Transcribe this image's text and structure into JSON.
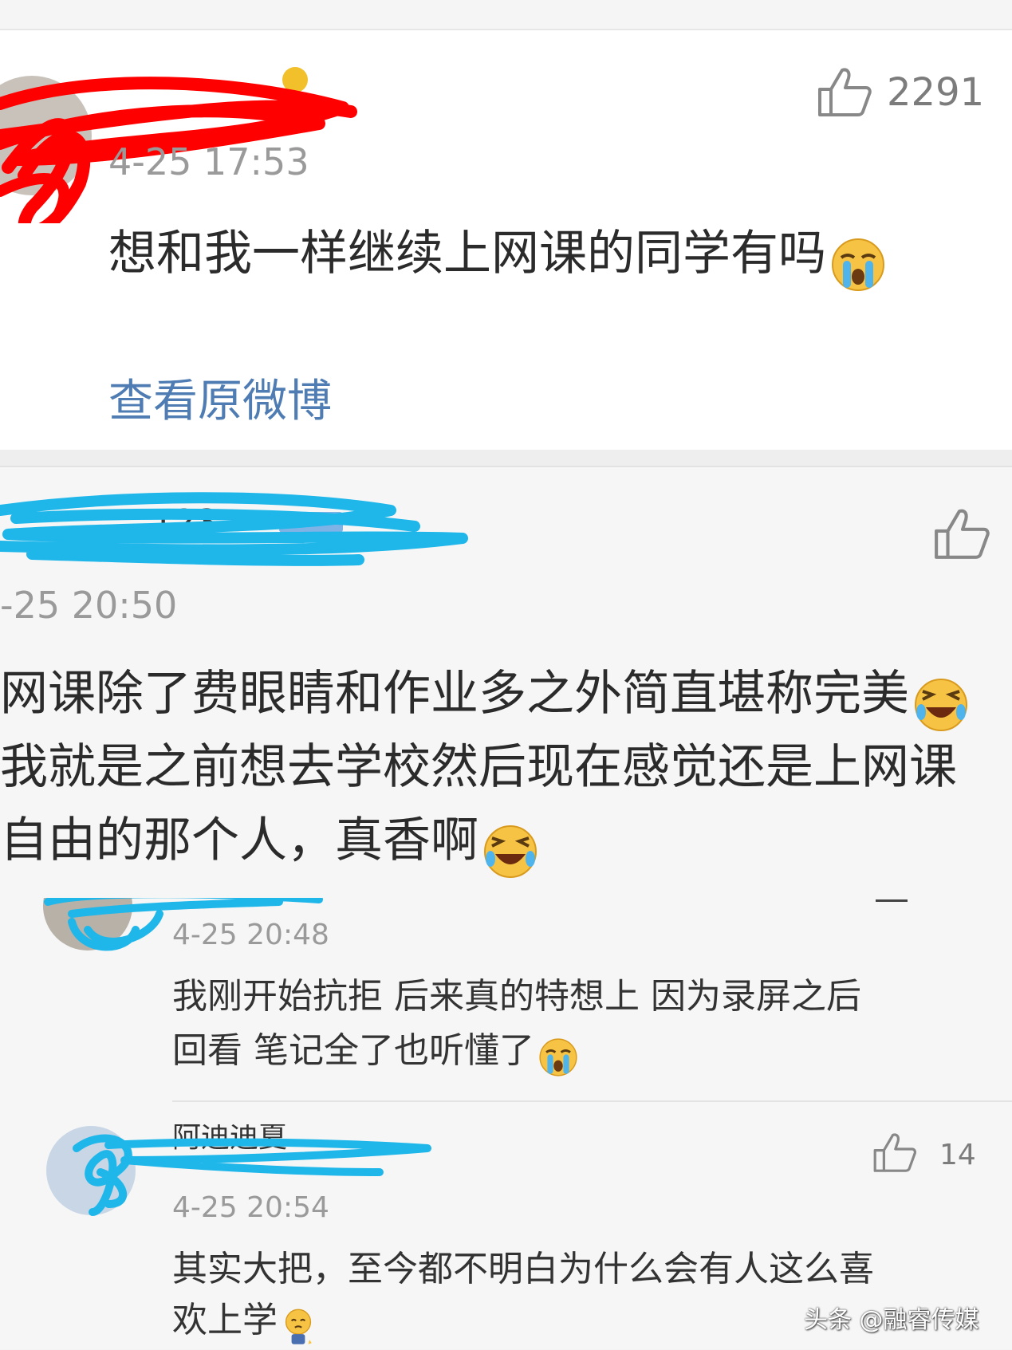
{
  "post": {
    "likes": "2291",
    "time": "4-25 17:53",
    "text": "想和我一样继续上网课的同学有吗",
    "view_original": "查看原微博"
  },
  "comment": {
    "time": "-25 20:50",
    "line1": "网课除了费眼睛和作业多之外简直堪称完美",
    "line2": "我就是之前想去学校然后现在感觉还是上网课",
    "line3": "自由的那个人，真香啊"
  },
  "replies": [
    {
      "time": "4-25 20:48",
      "line1": "我刚开始抗拒  后来真的特想上  因为录屏之后",
      "line2": "回看  笔记全了也听懂了"
    },
    {
      "likes": "14",
      "time": "4-25 20:54",
      "line1": "其实大把，至今都不明白为什么会有人这么喜",
      "line2": "欢上学"
    }
  ],
  "watermark": "头条 @融睿传媒",
  "icons": {
    "like": "thumbs-up-icon",
    "crying": "crying-emoji-icon",
    "laughing": "laughing-emoji-icon",
    "shy": "shy-emoji-icon"
  },
  "colors": {
    "link": "#4f7db3",
    "redact_red": "#ff0000",
    "redact_blue": "#1fb6ea"
  }
}
